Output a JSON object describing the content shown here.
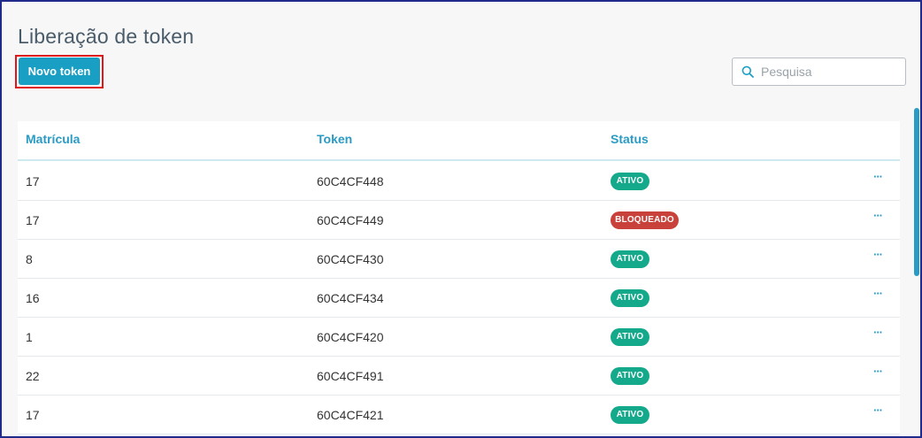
{
  "page": {
    "title": "Liberação de token"
  },
  "toolbar": {
    "new_button_label": "Novo token",
    "search_placeholder": "Pesquisa"
  },
  "table": {
    "columns": [
      "Matrícula",
      "Token",
      "Status"
    ],
    "rows": [
      {
        "matricula": "17",
        "token": "60C4CF448",
        "status": "ATIVO"
      },
      {
        "matricula": "17",
        "token": "60C4CF449",
        "status": "BLOQUEADO"
      },
      {
        "matricula": "8",
        "token": "60C4CF430",
        "status": "ATIVO"
      },
      {
        "matricula": "16",
        "token": "60C4CF434",
        "status": "ATIVO"
      },
      {
        "matricula": "1",
        "token": "60C4CF420",
        "status": "ATIVO"
      },
      {
        "matricula": "22",
        "token": "60C4CF491",
        "status": "ATIVO"
      },
      {
        "matricula": "17",
        "token": "60C4CF421",
        "status": "ATIVO"
      }
    ],
    "row_action_label": "···"
  },
  "colors": {
    "accent": "#1a9fc4",
    "status_active": "#13a98a",
    "status_blocked": "#c8413b",
    "highlight_border": "#e0161b"
  },
  "icons": {
    "search": "search-icon",
    "row_actions": "more-horizontal-icon"
  }
}
